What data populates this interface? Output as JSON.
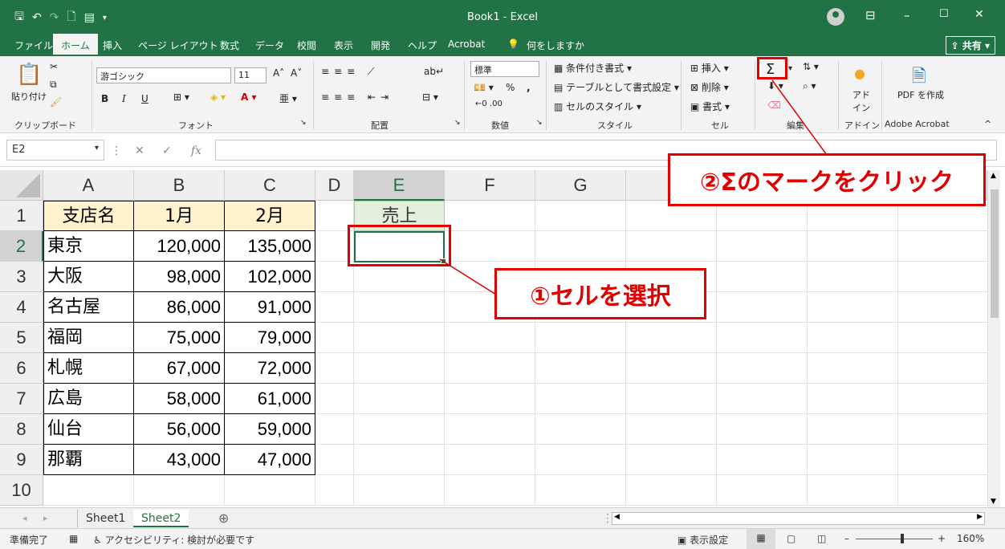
{
  "title_bar": {
    "title": "Book1 - Excel",
    "minimize": "–",
    "restore": "☐",
    "close": "✕"
  },
  "tabs": [
    "ファイル",
    "ホーム",
    "挿入",
    "ページ レイアウト",
    "数式",
    "データ",
    "校閲",
    "表示",
    "開発",
    "ヘルプ",
    "Acrobat",
    "何をしますか"
  ],
  "share_label": "共有",
  "ribbon": {
    "clipboard": {
      "paste": "貼り付け",
      "label": "クリップボード"
    },
    "font": {
      "name": "游ゴシック",
      "size": "11",
      "label": "フォント",
      "bold": "B",
      "italic": "I",
      "underline": "U"
    },
    "alignment": {
      "label": "配置"
    },
    "number": {
      "format": "標準",
      "label": "数値",
      "percent": "%",
      "comma": ","
    },
    "styles": {
      "conditional": "条件付き書式",
      "table": "テーブルとして書式設定",
      "cell_styles": "セルのスタイル",
      "label": "スタイル"
    },
    "cells": {
      "insert": "挿入",
      "delete": "削除",
      "format": "書式",
      "label": "セル"
    },
    "editing": {
      "sigma": "Σ",
      "label": "編集"
    },
    "addins": {
      "name": "アド イン",
      "label": "アドイン"
    },
    "acrobat": {
      "name": "PDF を作成",
      "label": "Adobe Acrobat"
    }
  },
  "formula_bar": {
    "name_box": "E2",
    "fx": "fx",
    "value": ""
  },
  "columns": [
    "A",
    "B",
    "C",
    "D",
    "E",
    "F",
    "G"
  ],
  "rows": [
    "1",
    "2",
    "3",
    "4",
    "5",
    "6",
    "7",
    "8",
    "9",
    "10"
  ],
  "table": {
    "headers": [
      "支店名",
      "1月",
      "2月"
    ],
    "sales_header": "売上",
    "data": [
      [
        "東京",
        "120,000",
        "135,000"
      ],
      [
        "大阪",
        "98,000",
        "102,000"
      ],
      [
        "名古屋",
        "86,000",
        "91,000"
      ],
      [
        "福岡",
        "75,000",
        "79,000"
      ],
      [
        "札幌",
        "67,000",
        "72,000"
      ],
      [
        "広島",
        "58,000",
        "61,000"
      ],
      [
        "仙台",
        "56,000",
        "59,000"
      ],
      [
        "那覇",
        "43,000",
        "47,000"
      ]
    ]
  },
  "sheets": [
    "Sheet1",
    "Sheet2"
  ],
  "active_sheet": "Sheet2",
  "status": {
    "ready": "準備完了",
    "accessibility": "アクセシビリティ: 検討が必要です",
    "display_settings": "表示設定",
    "zoom": "160%"
  },
  "callouts": {
    "step1": "①セルを選択",
    "step2": "②Σのマークをクリック"
  },
  "colors": {
    "excel_green": "#217346",
    "callout_red": "#e00000",
    "header_fill": "#fff2cc",
    "sales_fill": "#e2efda"
  }
}
